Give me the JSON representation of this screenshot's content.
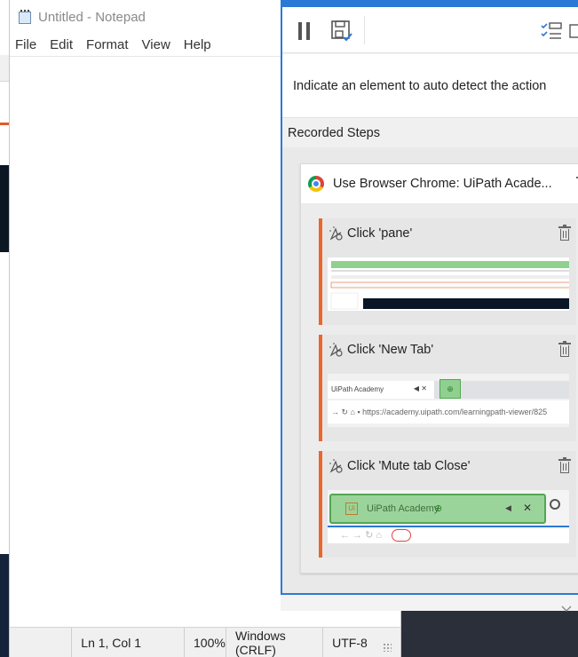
{
  "notepad": {
    "title": "Untitled - Notepad",
    "menu": [
      "File",
      "Edit",
      "Format",
      "View",
      "Help"
    ],
    "status": {
      "position": "Ln 1, Col 1",
      "zoom": "100%",
      "line_ending": "Windows (CRLF)",
      "encoding": "UTF-8"
    }
  },
  "recorder": {
    "info_text": "Indicate an element to auto detect the action",
    "steps_header": "Recorded Steps",
    "browser_card_title": "Use Browser Chrome: UiPath Acade...",
    "steps": [
      {
        "label": "Click 'pane'"
      },
      {
        "label": "Click 'New Tab'"
      },
      {
        "label": "Click 'Mute tab Close'"
      }
    ],
    "thumb_newtab": {
      "tab_label": "UiPath Academy",
      "url": "https://academy.uipath.com/learningpath-viewer/825"
    },
    "thumb_mute": {
      "tab_label": "UiPath Academy"
    }
  },
  "colors": {
    "accent_blue": "#2b79d6",
    "step_accent": "#e9662c",
    "highlight_green": "#8fd08f"
  }
}
